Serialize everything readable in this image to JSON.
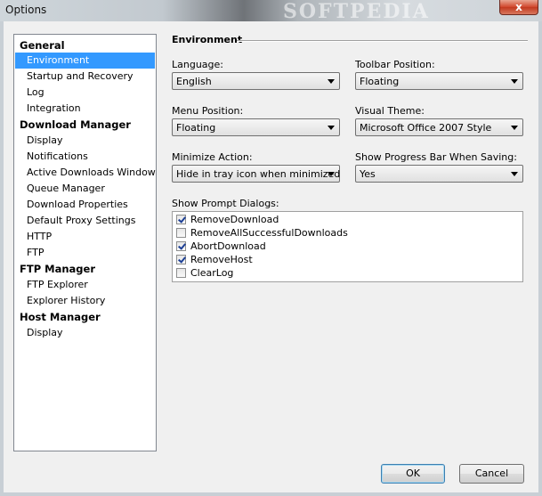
{
  "window": {
    "title": "Options",
    "watermark": "SOFTPEDIA",
    "close_glyph": "x"
  },
  "tree": {
    "groups": [
      {
        "label": "General",
        "items": [
          "Environment",
          "Startup and Recovery",
          "Log",
          "Integration"
        ]
      },
      {
        "label": "Download Manager",
        "items": [
          "Display",
          "Notifications",
          "Active Downloads Window",
          "Queue Manager",
          "Download Properties",
          "Default Proxy Settings",
          "HTTP",
          "FTP"
        ]
      },
      {
        "label": "FTP Manager",
        "items": [
          "FTP Explorer",
          "Explorer History"
        ]
      },
      {
        "label": "Host Manager",
        "items": [
          "Display"
        ]
      }
    ],
    "selected": "Environment"
  },
  "environment": {
    "section_title": "Environment",
    "language": {
      "label": "Language:",
      "value": "English"
    },
    "toolbar_position": {
      "label": "Toolbar Position:",
      "value": "Floating"
    },
    "menu_position": {
      "label": "Menu Position:",
      "value": "Floating"
    },
    "visual_theme": {
      "label": "Visual Theme:",
      "value": "Microsoft Office 2007 Style"
    },
    "minimize_action": {
      "label": "Minimize Action:",
      "value": "Hide in tray icon when minimized"
    },
    "progress_bar": {
      "label": "Show Progress Bar When Saving:",
      "value": "Yes"
    },
    "prompt_dialogs": {
      "label": "Show Prompt Dialogs:",
      "items": [
        {
          "label": "RemoveDownload",
          "checked": true
        },
        {
          "label": "RemoveAllSuccessfulDownloads",
          "checked": false
        },
        {
          "label": "AbortDownload",
          "checked": true
        },
        {
          "label": "RemoveHost",
          "checked": true
        },
        {
          "label": "ClearLog",
          "checked": false
        }
      ]
    }
  },
  "buttons": {
    "ok": "OK",
    "cancel": "Cancel"
  }
}
